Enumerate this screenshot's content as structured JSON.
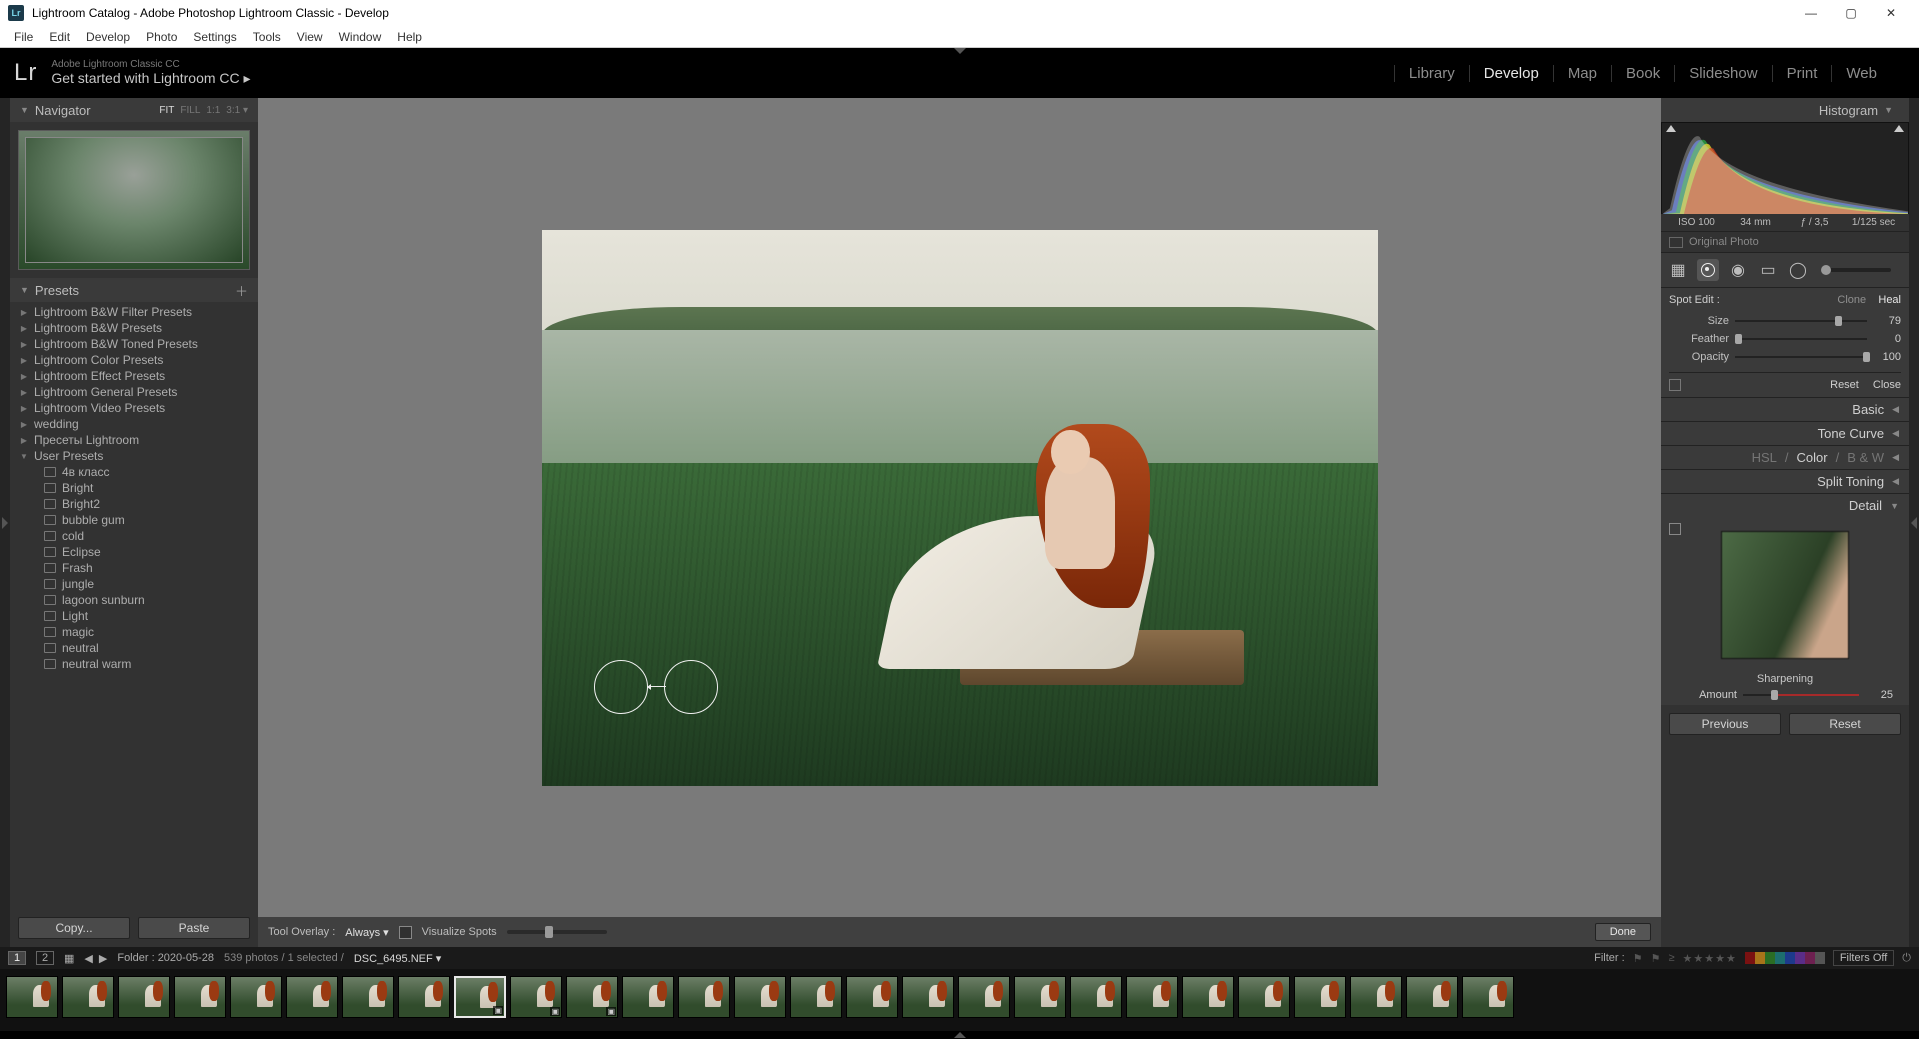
{
  "window": {
    "title": "Lightroom Catalog - Adobe Photoshop Lightroom Classic - Develop",
    "app_badge": "Lr"
  },
  "menubar": [
    "File",
    "Edit",
    "Develop",
    "Photo",
    "Settings",
    "Tools",
    "View",
    "Window",
    "Help"
  ],
  "topbar": {
    "logo": "Lr",
    "subtitle_small": "Adobe Lightroom Classic CC",
    "subtitle_big": "Get started with Lightroom CC  ▸",
    "modules": [
      "Library",
      "Develop",
      "Map",
      "Book",
      "Slideshow",
      "Print",
      "Web"
    ],
    "active_module": "Develop"
  },
  "navigator": {
    "title": "Navigator",
    "modes": {
      "fit": "FIT",
      "fill": "FILL",
      "one": "1:1",
      "ratio": "3:1  ▾"
    }
  },
  "presets": {
    "title": "Presets",
    "folders": [
      "Lightroom B&W Filter Presets",
      "Lightroom B&W Presets",
      "Lightroom B&W Toned Presets",
      "Lightroom Color Presets",
      "Lightroom Effect Presets",
      "Lightroom General Presets",
      "Lightroom Video Presets",
      "wedding",
      "Пресеты Lightroom",
      "User Presets"
    ],
    "user_presets": [
      "4в класс",
      "Bright",
      "Bright2",
      "bubble gum",
      "cold",
      "Eclipse",
      "Frash",
      "jungle",
      "lagoon sunburn",
      "Light",
      "magic",
      "neutral",
      "neutral warm"
    ]
  },
  "left_buttons": {
    "copy": "Copy...",
    "paste": "Paste"
  },
  "center_footer": {
    "overlay_label": "Tool Overlay :",
    "overlay_value": "Always  ▾",
    "visualize": "Visualize Spots",
    "done": "Done"
  },
  "histogram": {
    "title": "Histogram",
    "iso": "ISO 100",
    "focal": "34 mm",
    "aperture": "ƒ / 3,5",
    "shutter": "1/125 sec",
    "original": "Original Photo"
  },
  "spot": {
    "title": "Spot Edit :",
    "clone": "Clone",
    "heal": "Heal",
    "size_label": "Size",
    "size_val": "79",
    "feather_label": "Feather",
    "feather_val": "0",
    "opacity_label": "Opacity",
    "opacity_val": "100",
    "reset": "Reset",
    "close": "Close"
  },
  "sections": {
    "basic": "Basic",
    "tone": "Tone Curve",
    "hsl": "HSL",
    "color": "Color",
    "bw": "B & W",
    "split": "Split Toning",
    "detail": "Detail"
  },
  "sharpening": {
    "title": "Sharpening",
    "amount_label": "Amount",
    "amount_val": "25"
  },
  "right_buttons": {
    "prev": "Previous",
    "reset": "Reset"
  },
  "secondary": {
    "folder": "Folder : 2020-05-28",
    "count": "539 photos / 1 selected  /",
    "filename": "DSC_6495.NEF  ▾",
    "filter_label": "Filter :",
    "filters_off": "Filters Off"
  },
  "filmstrip": {
    "count": 27,
    "selected": 8
  },
  "swatches": [
    "#7a1111",
    "#a8741a",
    "#2a6d24",
    "#1d6e6e",
    "#1d3a8c",
    "#5a2d88",
    "#6d2050",
    "#555555"
  ]
}
